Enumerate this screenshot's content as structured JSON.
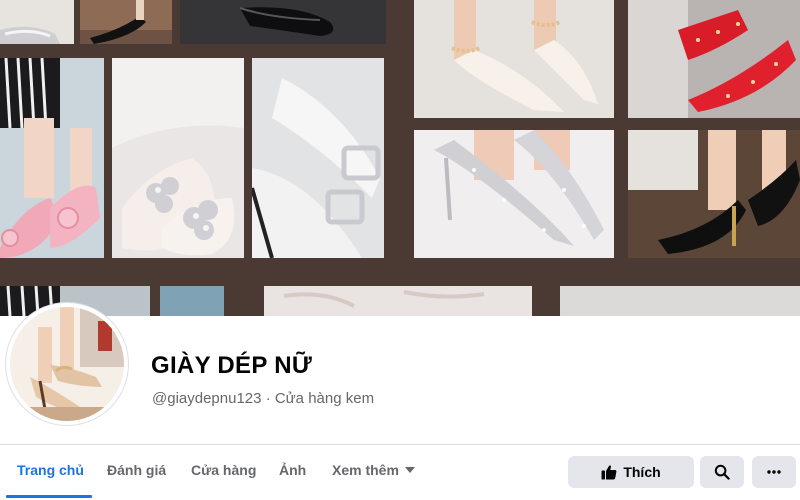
{
  "page": {
    "name": "GIÀY DÉP NỮ",
    "subtitle": "@giaydepnu123 · Cửa hàng kem"
  },
  "tabs": [
    {
      "label": "Trang chủ",
      "active": true
    },
    {
      "label": "Đánh giá",
      "active": false
    },
    {
      "label": "Cửa hàng",
      "active": false
    },
    {
      "label": "Ảnh",
      "active": false
    },
    {
      "label": "Xem thêm",
      "active": false,
      "dropdown": true
    }
  ],
  "actions": {
    "like_label": "Thích",
    "like_icon": "thumbs-up-icon",
    "search_icon": "search-icon",
    "more_icon": "more-dots-icon"
  },
  "colors": {
    "accent": "#1b74e4",
    "button_bg": "#e4e6eb",
    "secondary_text": "#65676b",
    "collage_frame": "#4a3a33"
  }
}
